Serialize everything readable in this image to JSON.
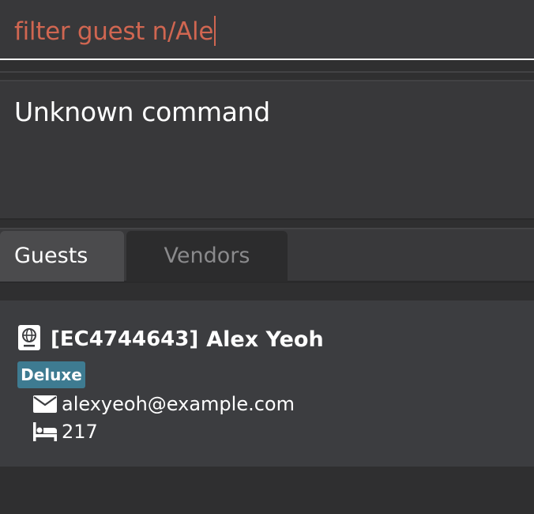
{
  "command_box": {
    "value": "filter guest n/Ale"
  },
  "result_display": {
    "message": "Unknown command"
  },
  "tabs": [
    {
      "label": "Guests",
      "selected": true
    },
    {
      "label": "Vendors",
      "selected": false
    }
  ],
  "guest_list": [
    {
      "id": "[EC4744643]",
      "name": "Alex Yeoh",
      "tag": "Deluxe",
      "email": "alexyeoh@example.com",
      "room": "217",
      "icons": {
        "id": "passport-icon",
        "email": "mail-icon",
        "room": "bed-icon"
      }
    }
  ],
  "colors": {
    "command_text": "#d06651",
    "tag_background": "#3e7b91",
    "background": "#2f2f30"
  }
}
